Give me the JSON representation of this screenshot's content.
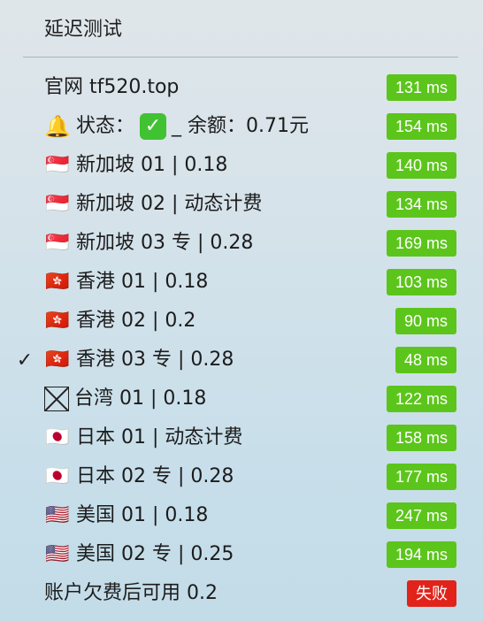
{
  "menu": {
    "title": "延迟测试"
  },
  "items": [
    {
      "check": "",
      "flag": "",
      "label": "官网 tf520.top",
      "latency": "131 ms",
      "status": "ok"
    },
    {
      "check": "",
      "flag": "🔔",
      "label_pre": "状态：",
      "label_check": "✓",
      "label_post": "_ 余额：0.71元",
      "latency": "154 ms",
      "status": "ok"
    },
    {
      "check": "",
      "flag": "🇸🇬",
      "label": "新加坡 01 | 0.18",
      "latency": "140 ms",
      "status": "ok"
    },
    {
      "check": "",
      "flag": "🇸🇬",
      "label": "新加坡 02 | 动态计费",
      "latency": "134 ms",
      "status": "ok"
    },
    {
      "check": "",
      "flag": "🇸🇬",
      "label": "新加坡 03 专 | 0.28",
      "latency": "169 ms",
      "status": "ok"
    },
    {
      "check": "",
      "flag": "🇭🇰",
      "label": "香港 01 | 0.18",
      "latency": "103 ms",
      "status": "ok"
    },
    {
      "check": "",
      "flag": "🇭🇰",
      "label": "香港 02 | 0.2",
      "latency": "90 ms",
      "status": "ok"
    },
    {
      "check": "✓",
      "flag": "🇭🇰",
      "label": "香港 03 专 | 0.28",
      "latency": "48 ms",
      "status": "ok"
    },
    {
      "check": "",
      "flag": "box",
      "label": "台湾 01 | 0.18",
      "latency": "122 ms",
      "status": "ok"
    },
    {
      "check": "",
      "flag": "🇯🇵",
      "label": "日本 01 | 动态计费",
      "latency": "158 ms",
      "status": "ok"
    },
    {
      "check": "",
      "flag": "🇯🇵",
      "label": "日本 02 专 | 0.28",
      "latency": "177 ms",
      "status": "ok"
    },
    {
      "check": "",
      "flag": "🇺🇸",
      "label": "美国 01 | 0.18",
      "latency": "247 ms",
      "status": "ok"
    },
    {
      "check": "",
      "flag": "🇺🇸",
      "label": "美国 02 专 | 0.25",
      "latency": "194 ms",
      "status": "ok"
    },
    {
      "check": "",
      "flag": "",
      "label": "账户欠费后可用 0.2",
      "latency": "失败",
      "status": "fail"
    }
  ],
  "colors": {
    "ok_badge": "#5cc51b",
    "fail_badge": "#e2231a"
  },
  "icons": {
    "selected": "checkmark-icon",
    "bell": "bell-icon",
    "check_box": "green-check-box-icon",
    "missing_flag": "missing-glyph-icon"
  }
}
